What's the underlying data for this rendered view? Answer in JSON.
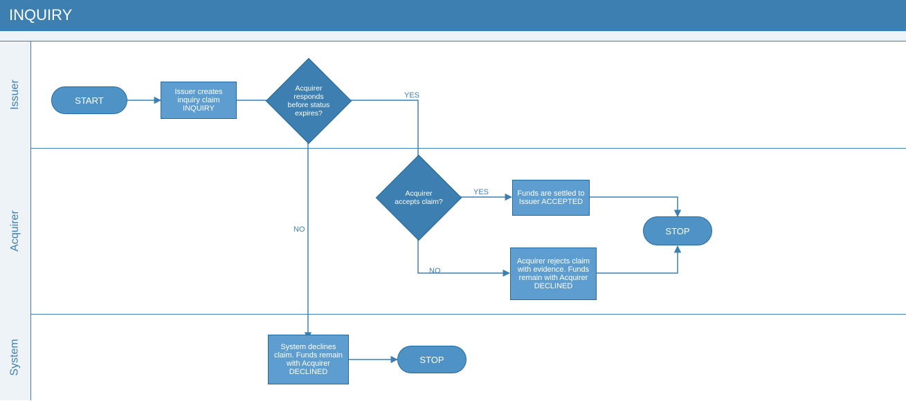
{
  "title": "INQUIRY",
  "lanes": {
    "issuer": "Issuer",
    "acquirer": "Acquirer",
    "system": "System"
  },
  "nodes": {
    "start": "START",
    "issuer_creates": "Issuer creates inquiry claim INQUIRY",
    "acq_responds": "Acquirer responds before status expires?",
    "acq_accepts": "Acquirer accepts claim?",
    "funds_settled": "Funds are settled to Issuer ACCEPTED",
    "acq_rejects": "Acquirer rejects claim with evidence. Funds remain with Acquirer DECLINED",
    "stop_acq": "STOP",
    "sys_declines": "System declines claim. Funds remain with Acquirer DECLINED",
    "stop_sys": "STOP"
  },
  "edge_labels": {
    "yes1": "YES",
    "no1": "NO",
    "yes2": "YES",
    "no2": "NO"
  },
  "chart_data": {
    "type": "flowchart-swimlane",
    "title": "INQUIRY",
    "lanes": [
      "Issuer",
      "Acquirer",
      "System"
    ],
    "nodes": [
      {
        "id": "start",
        "lane": "Issuer",
        "type": "terminator",
        "label": "START"
      },
      {
        "id": "n1",
        "lane": "Issuer",
        "type": "process",
        "label": "Issuer creates inquiry claim INQUIRY"
      },
      {
        "id": "d1",
        "lane": "Issuer",
        "type": "decision",
        "label": "Acquirer responds before status expires?"
      },
      {
        "id": "d2",
        "lane": "Acquirer",
        "type": "decision",
        "label": "Acquirer accepts claim?"
      },
      {
        "id": "n2",
        "lane": "Acquirer",
        "type": "process",
        "label": "Funds are settled to Issuer ACCEPTED"
      },
      {
        "id": "n3",
        "lane": "Acquirer",
        "type": "process",
        "label": "Acquirer rejects claim with evidence. Funds remain with Acquirer DECLINED"
      },
      {
        "id": "stop1",
        "lane": "Acquirer",
        "type": "terminator",
        "label": "STOP"
      },
      {
        "id": "n4",
        "lane": "System",
        "type": "process",
        "label": "System declines claim. Funds remain with Acquirer DECLINED"
      },
      {
        "id": "stop2",
        "lane": "System",
        "type": "terminator",
        "label": "STOP"
      }
    ],
    "edges": [
      {
        "from": "start",
        "to": "n1"
      },
      {
        "from": "n1",
        "to": "d1"
      },
      {
        "from": "d1",
        "to": "d2",
        "label": "YES"
      },
      {
        "from": "d1",
        "to": "n4",
        "label": "NO"
      },
      {
        "from": "d2",
        "to": "n2",
        "label": "YES"
      },
      {
        "from": "d2",
        "to": "n3",
        "label": "NO"
      },
      {
        "from": "n2",
        "to": "stop1"
      },
      {
        "from": "n3",
        "to": "stop1"
      },
      {
        "from": "n4",
        "to": "stop2"
      }
    ]
  }
}
